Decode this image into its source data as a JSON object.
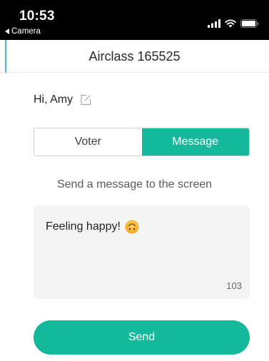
{
  "status_bar": {
    "time": "10:53",
    "back_label": "Camera",
    "icons": [
      "cellular-signal-icon",
      "wifi-icon",
      "battery-icon"
    ]
  },
  "header": {
    "title": "Airclass 165525"
  },
  "greeting": {
    "text": "Hi, Amy",
    "edit_icon": "edit-icon"
  },
  "tabs": [
    {
      "label": "Voter",
      "active": false
    },
    {
      "label": "Message",
      "active": true
    }
  ],
  "instruction": "Send a message to the screen",
  "message": {
    "text": "Feeling happy!",
    "emoji": "upside-down-face-emoji",
    "remaining_count": "103"
  },
  "send_button": {
    "label": "Send"
  },
  "colors": {
    "accent": "#13b99a",
    "status_bar": "#000000",
    "message_box": "#f4f4f4",
    "side_rule": "#52aee0"
  }
}
